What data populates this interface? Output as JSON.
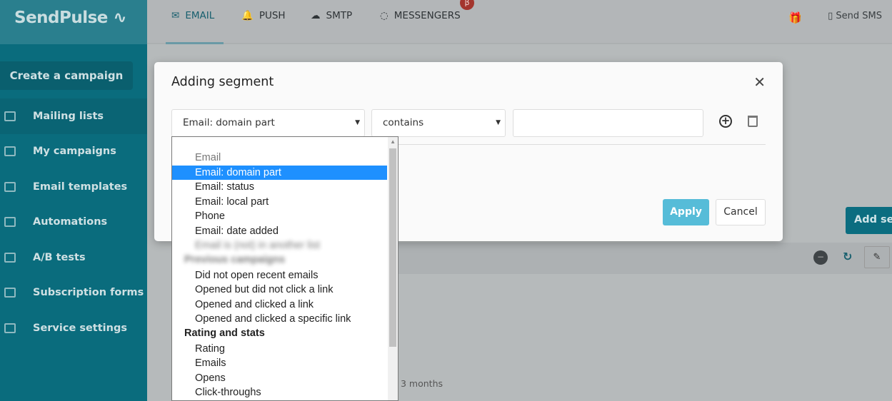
{
  "app": {
    "logo": "SendPulse"
  },
  "sidebar": {
    "create_label": "Create a campaign",
    "items": [
      {
        "label": "Mailing lists",
        "active": true
      },
      {
        "label": "My campaigns"
      },
      {
        "label": "Email templates"
      },
      {
        "label": "Automations"
      },
      {
        "label": "A/B tests"
      },
      {
        "label": "Subscription forms"
      },
      {
        "label": "Service settings"
      }
    ]
  },
  "topbar": {
    "tabs": [
      {
        "label": "EMAIL",
        "icon": "envelope-icon"
      },
      {
        "label": "PUSH",
        "icon": "bell-icon"
      },
      {
        "label": "SMTP",
        "icon": "cloud-upload-icon"
      },
      {
        "label": "MESSENGERS",
        "icon": "chat-icon"
      }
    ],
    "beta": "β",
    "send_sms": "Send SMS"
  },
  "modal": {
    "title": "Adding segment",
    "field_select": "Email: domain part",
    "operator_select": "contains",
    "value_input": "",
    "apply": "Apply",
    "cancel": "Cancel"
  },
  "dropdown": {
    "options": [
      {
        "label": "Email",
        "type": "disabled"
      },
      {
        "label": "Email: domain part",
        "type": "selected"
      },
      {
        "label": "Email: status"
      },
      {
        "label": "Email: local part"
      },
      {
        "label": "Phone"
      },
      {
        "label": "Email: date added"
      },
      {
        "label": "Email is (not) in another list",
        "type": "blurred"
      },
      {
        "label": "Previous campaigns",
        "type": "group-blurred"
      },
      {
        "label": "Did not open recent emails"
      },
      {
        "label": "Opened but did not click a link"
      },
      {
        "label": "Opened and clicked a link"
      },
      {
        "label": "Opened and clicked a specific link"
      },
      {
        "label": "Rating and stats",
        "type": "group"
      },
      {
        "label": "Rating"
      },
      {
        "label": "Emails"
      },
      {
        "label": "Opens"
      },
      {
        "label": "Click-throughs"
      }
    ]
  },
  "background": {
    "add_segment": "Add segment",
    "months": "3 months",
    "edit_icon": "✎"
  },
  "colors": {
    "accent": "#0b6d80",
    "apply": "#56bcd8",
    "highlight": "#1e90ff"
  }
}
